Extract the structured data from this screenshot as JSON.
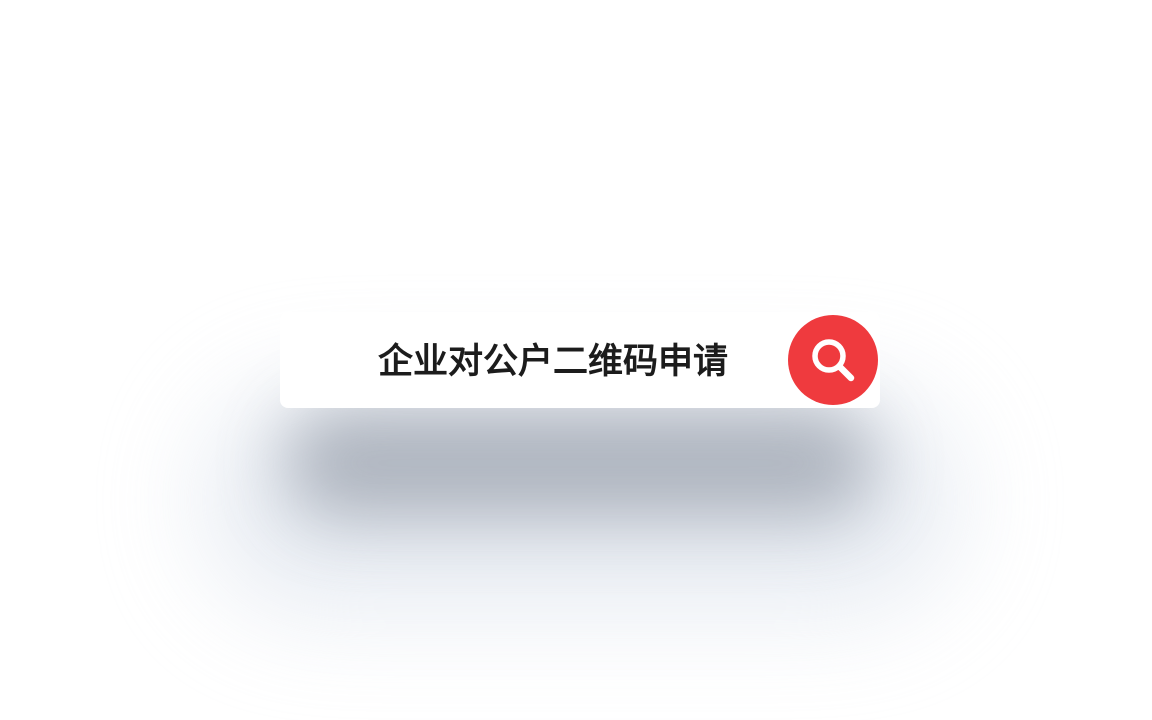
{
  "search": {
    "query": "企业对公户二维码申请",
    "icon": "search-icon"
  },
  "colors": {
    "accent": "#ef3a3e",
    "text": "#1c1c1c",
    "background": "#ffffff"
  }
}
